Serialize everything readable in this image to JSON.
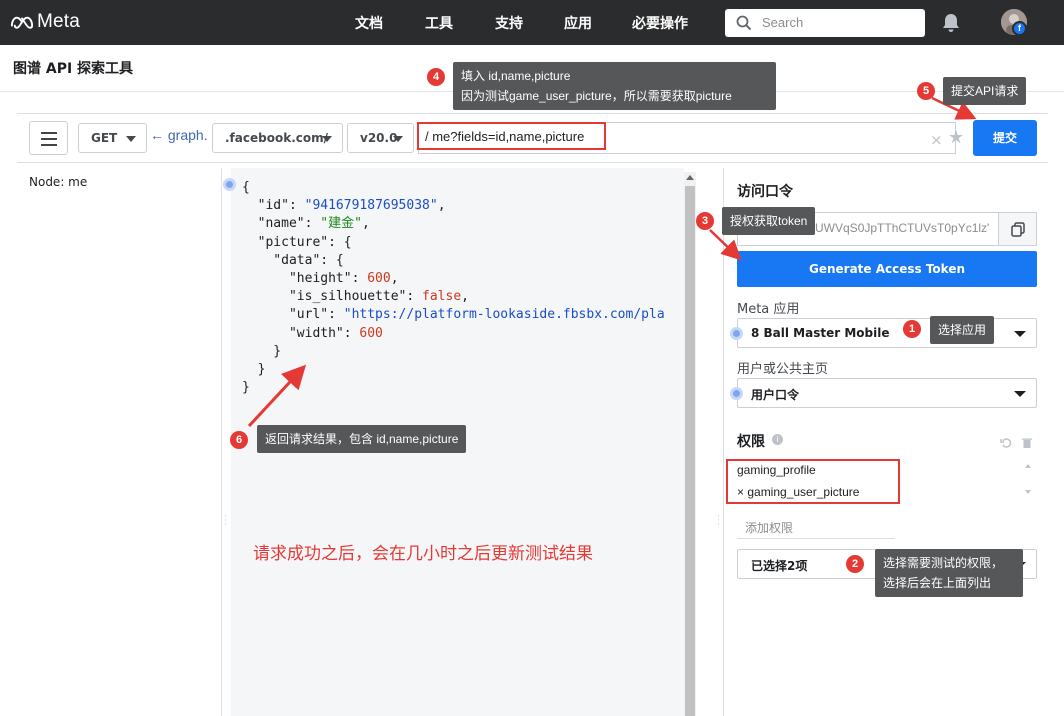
{
  "nav": {
    "brand": "Meta",
    "links": [
      "文档",
      "工具",
      "支持",
      "应用",
      "必要操作"
    ],
    "search_placeholder": "Search"
  },
  "page": {
    "title": "图谱 API 探索工具"
  },
  "toolbar": {
    "method": "GET",
    "host_prefix": "← graph.",
    "host_suffix": ".facebook.com/",
    "version": "v20.0",
    "path": "/   me?fields=id,name,picture",
    "submit_label": "提交"
  },
  "left": {
    "node_label": "Node:  me"
  },
  "response": {
    "lines": [
      [
        {
          "t": "{",
          "c": "k"
        }
      ],
      [
        {
          "t": "  \"id\"",
          "c": "k"
        },
        {
          "t": ": ",
          "c": "k"
        },
        {
          "t": "\"941679187695038\"",
          "c": "s"
        },
        {
          "t": ",",
          "c": "k"
        }
      ],
      [
        {
          "t": "  \"name\"",
          "c": "k"
        },
        {
          "t": ": ",
          "c": "k"
        },
        {
          "t": "\"建金\"",
          "c": "s-green"
        },
        {
          "t": ",",
          "c": "k"
        }
      ],
      [
        {
          "t": "  \"picture\"",
          "c": "k"
        },
        {
          "t": ": {",
          "c": "k"
        }
      ],
      [
        {
          "t": "    \"data\"",
          "c": "k"
        },
        {
          "t": ": {",
          "c": "k"
        }
      ],
      [
        {
          "t": "      \"height\"",
          "c": "k"
        },
        {
          "t": ": ",
          "c": "k"
        },
        {
          "t": "600",
          "c": "n"
        },
        {
          "t": ",",
          "c": "k"
        }
      ],
      [
        {
          "t": "      \"is_silhouette\"",
          "c": "k"
        },
        {
          "t": ": ",
          "c": "k"
        },
        {
          "t": "false",
          "c": "n"
        },
        {
          "t": ",",
          "c": "k"
        }
      ],
      [
        {
          "t": "      \"url\"",
          "c": "k"
        },
        {
          "t": ": ",
          "c": "k"
        },
        {
          "t": "\"https://platform-lookaside.fbsbx.com/pla",
          "c": "s"
        }
      ],
      [
        {
          "t": "      \"width\"",
          "c": "k"
        },
        {
          "t": ": ",
          "c": "k"
        },
        {
          "t": "600",
          "c": "n"
        }
      ],
      [
        {
          "t": "    }",
          "c": "k"
        }
      ],
      [
        {
          "t": "  }",
          "c": "k"
        }
      ],
      [
        {
          "t": "}",
          "c": "k"
        }
      ]
    ]
  },
  "right": {
    "token_heading": "访问口令",
    "token_value": "G8QVIZAUWVqS0JpTThCTUVsT0pYc1lz'",
    "generate_label": "Generate Access Token",
    "app_label": "Meta 应用",
    "app_value": "8 Ball Master Mobile",
    "user_label": "用户或公共主页",
    "user_value": "用户口令",
    "perm_heading": "权限",
    "permissions": [
      "gaming_profile",
      "× gaming_user_picture"
    ],
    "add_perm_placeholder": "添加权限",
    "selected_count": "已选择2项"
  },
  "annotations": {
    "badges": [
      "1",
      "2",
      "3",
      "4",
      "5",
      "6"
    ],
    "tip1": "选择应用",
    "tip2_line1": "选择需要测试的权限，",
    "tip2_line2": "选择后会在上面列出",
    "tip3": "授权获取token",
    "tip4_line1": "填入 id,name,picture",
    "tip4_line2": "因为测试game_user_picture，所以需要获取picture",
    "tip5": "提交API请求",
    "tip6": "返回请求结果，包含 id,name,picture",
    "note": "请求成功之后，会在几小时之后更新测试结果"
  },
  "colors": {
    "nav_bg": "#2b2c2e",
    "primary": "#1877f2",
    "annotation_red": "#e53935",
    "tooltip_bg": "#555759",
    "json_string": "#1a4dc8",
    "json_number": "#d0361f"
  }
}
